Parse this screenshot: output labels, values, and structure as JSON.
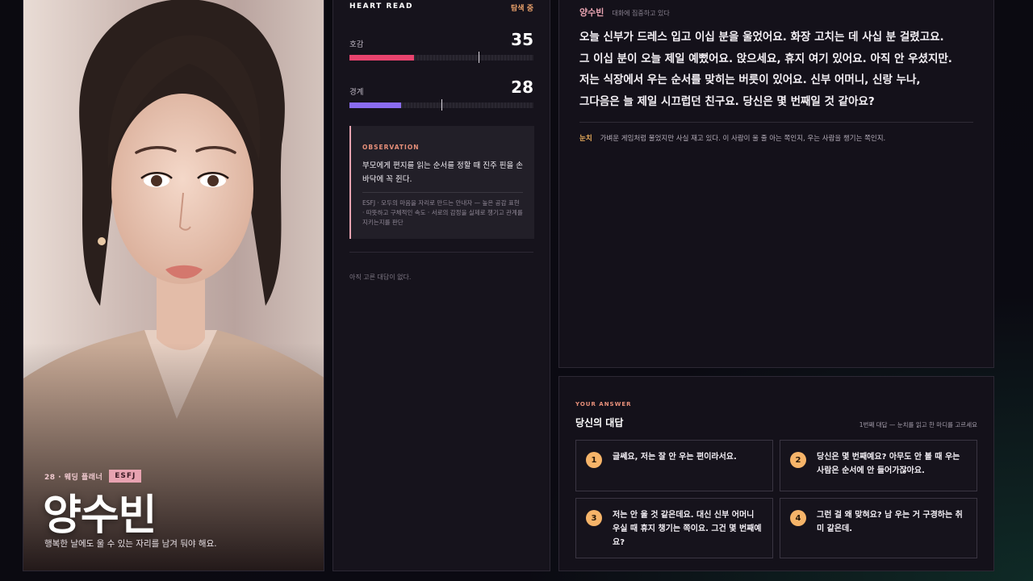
{
  "character": {
    "age_role": "28 · 웨딩 플래너",
    "mbti": "ESFJ",
    "name": "양수빈",
    "tagline": "행복한 날에도 울 수 있는 자리를 남겨 둬야 해요."
  },
  "heart_read": {
    "title": "HEART READ",
    "status": "탐색 중",
    "gauges": [
      {
        "label": "호감",
        "value": "35",
        "fraction": 0.35,
        "marker": 0.7,
        "color": "#e8436e"
      },
      {
        "label": "경계",
        "value": "28",
        "fraction": 0.28,
        "marker": 0.5,
        "color": "#8a6cf0"
      }
    ],
    "observation": {
      "label": "OBSERVATION",
      "text": "부모에게 편지를 읽는 순서를 정할 때 진주 핀을 손바닥에 꼭 쥔다.",
      "note": "ESFJ · 모두의 마음을 자리로 만드는 안내자 — 높은 공감 표현 · 따뜻하고 구체적인 속도 · 서로의 감정을 실제로 챙기고 관계를 지키는지를 판단"
    },
    "empty_note": "아직 고른 대답이 없다."
  },
  "dialogue": {
    "speaker": "양수빈",
    "state": "대화에 집중하고 있다",
    "lines": [
      "오늘 신부가 드레스 입고 이십 분을 울었어요. 화장 고치는 데 사십 분 걸렸고요.",
      "그 이십 분이 오늘 제일 예뻤어요. 앉으세요, 휴지 여기 있어요. 아직 안 우셨지만.",
      "저는 식장에서 우는 순서를 맞히는 버릇이 있어요. 신부 어머니, 신랑 누나,",
      "그다음은 늘 제일 시끄럽던 친구요. 당신은 몇 번째일 것 같아요?"
    ],
    "insight_tag": "눈치",
    "insight_text": "가벼운 게임처럼 물었지만 사실 재고 있다. 이 사람이 울 줄 아는 쪽인지, 우는 사람을 챙기는 쪽인지."
  },
  "answer": {
    "kicker": "YOUR ANSWER",
    "title": "당신의 대답",
    "hint": "1번째 대답 — 눈치를 읽고 한 마디를 고르세요",
    "choices": [
      {
        "num": "1",
        "text": "글쎄요, 저는 잘 안 우는 편이라서요."
      },
      {
        "num": "2",
        "text": "당신은 몇 번째예요? 아무도 안 볼 때 우는 사람은 순서에 안 들어가잖아요."
      },
      {
        "num": "3",
        "text": "저는 안 울 것 같은데요. 대신 신부 어머니 우실 때 휴지 챙기는 쪽이요. 그건 몇 번째예요?"
      },
      {
        "num": "4",
        "text": "그런 걸 왜 맞혀요? 남 우는 거 구경하는 취미 같은데."
      }
    ]
  }
}
